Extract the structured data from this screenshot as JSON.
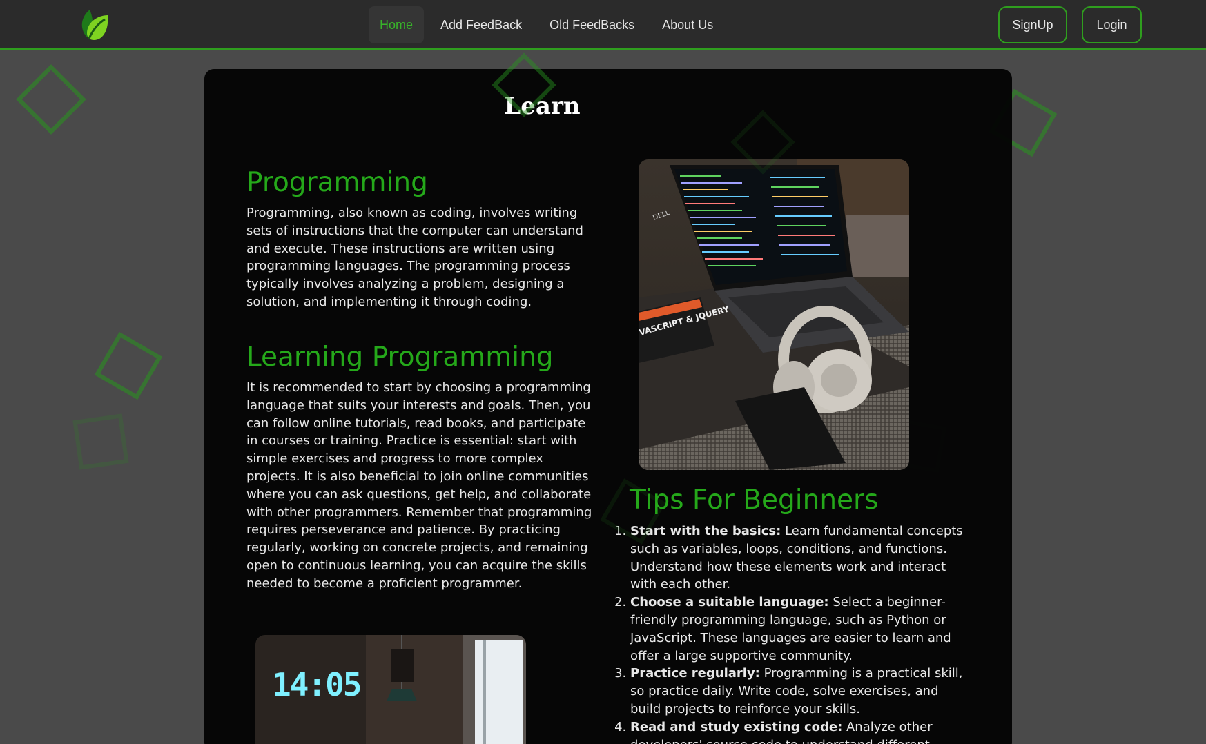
{
  "nav": {
    "links": [
      "Home",
      "Add FeedBack",
      "Old FeedBacks",
      "About Us"
    ],
    "signup": "SignUp",
    "login": "Login"
  },
  "page": {
    "title": "Learn"
  },
  "sections": {
    "programming": {
      "heading": "Programming",
      "text": "Programming, also known as coding, involves writing sets of instructions that the computer can understand and execute. These instructions are written using programming languages. The programming process typically involves analyzing a problem, designing a solution, and implementing it through coding."
    },
    "learning": {
      "heading": "Learning Programming",
      "text": "It is recommended to start by choosing a programming language that suits your interests and goals. Then, you can follow online tutorials, read books, and participate in courses or training. Practice is essential: start with simple exercises and progress to more complex projects. It is also beneficial to join online communities where you can ask questions, get help, and collaborate with other programmers. Remember that programming requires perseverance and patience. By practicing regularly, working on concrete projects, and remaining open to continuous learning, you can acquire the skills needed to become a proficient programmer."
    },
    "tips": {
      "heading": "Tips For Beginners",
      "items": [
        {
          "title": "Start with the basics:",
          "text": " Learn fundamental concepts such as variables, loops, conditions, and functions. Understand how these elements work and interact with each other."
        },
        {
          "title": "Choose a suitable language:",
          "text": " Select a beginner-friendly programming language, such as Python or JavaScript. These languages are easier to learn and offer a large supportive community."
        },
        {
          "title": "Practice regularly:",
          "text": " Programming is a practical skill, so practice daily. Write code, solve exercises, and build projects to reinforce your skills."
        },
        {
          "title": "Read and study existing code:",
          "text": " Analyze other developers' source code to understand different"
        }
      ]
    }
  },
  "images": {
    "laptop": {
      "book_text": "VASCRIPT & JQUERY",
      "brand": "DELL"
    },
    "clock": {
      "time": "14:05"
    }
  },
  "colors": {
    "accent": "#25a81a",
    "nav_bg": "#2b2b2b",
    "card_bg": "#040404",
    "page_bg": "#4a4a4a"
  }
}
